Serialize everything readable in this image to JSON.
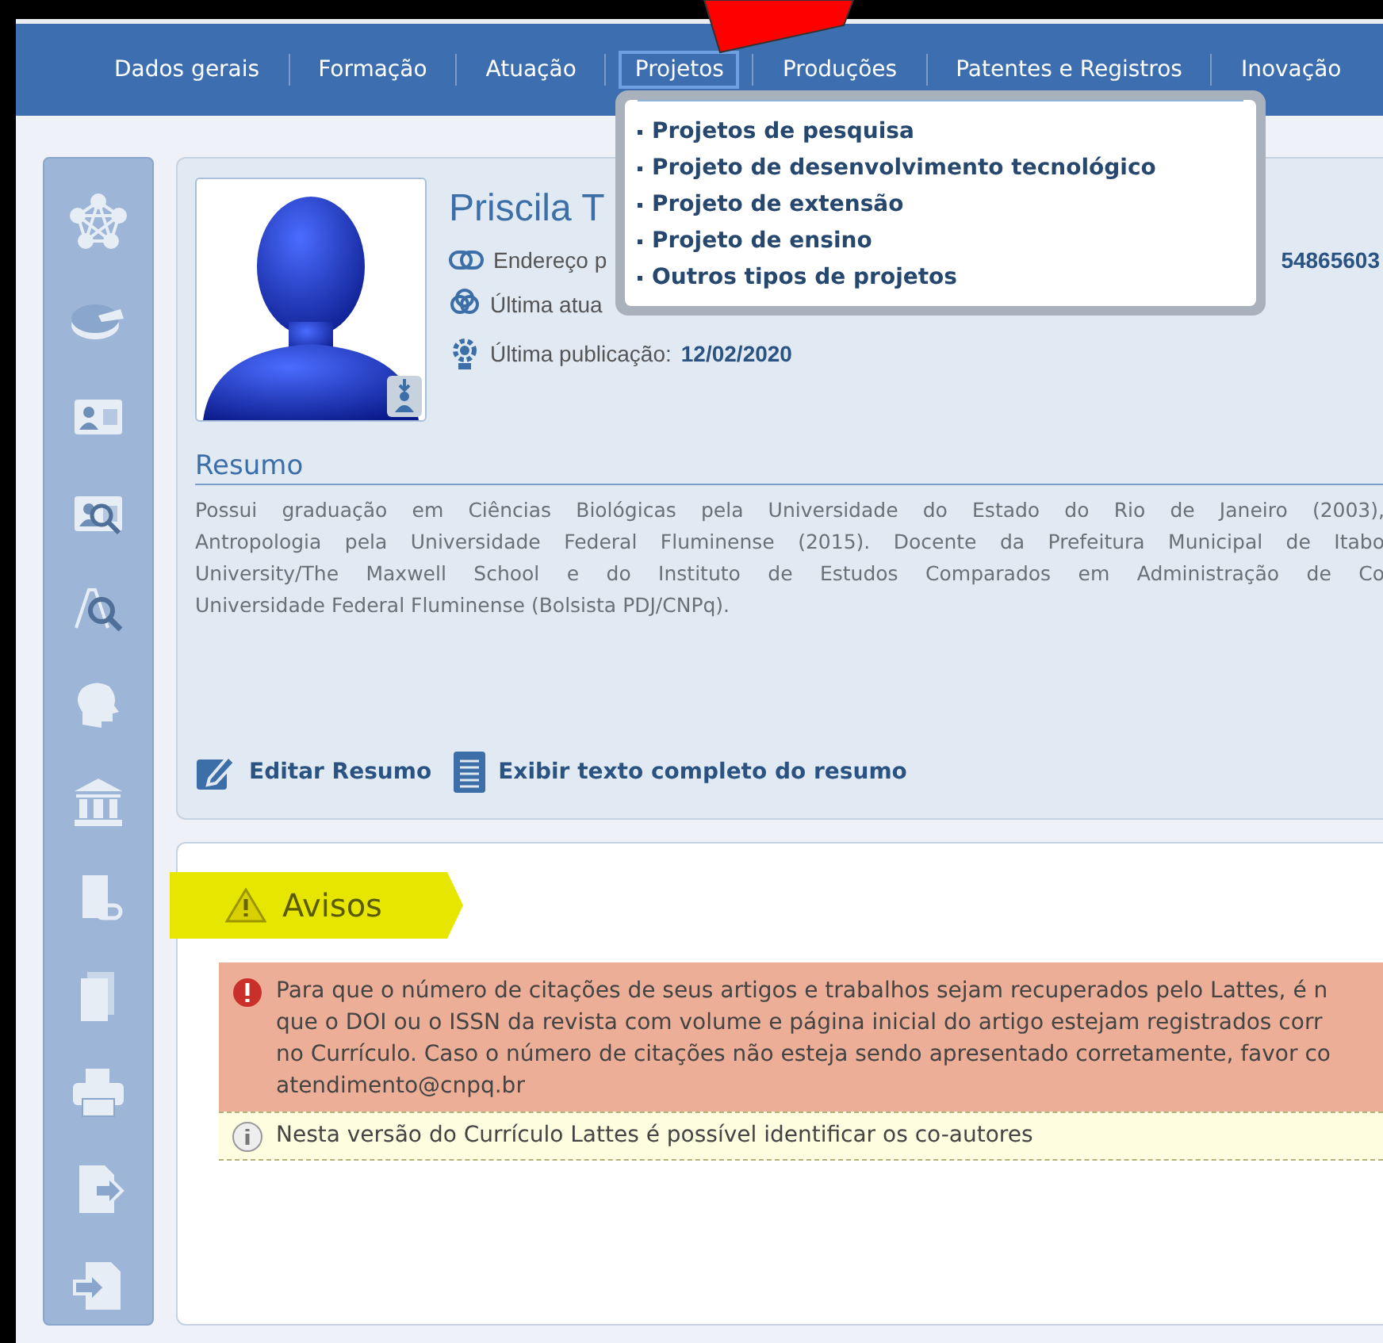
{
  "nav": {
    "items": [
      {
        "label": "Dados gerais",
        "selected": false
      },
      {
        "label": "Formação",
        "selected": false
      },
      {
        "label": "Atuação",
        "selected": false
      },
      {
        "label": "Projetos",
        "selected": true
      },
      {
        "label": "Produções",
        "selected": false
      },
      {
        "label": "Patentes e Registros",
        "selected": false
      },
      {
        "label": "Inovação",
        "selected": false
      }
    ]
  },
  "dropdown": {
    "items": [
      "Projetos de pesquisa",
      "Projeto de desenvolvimento tecnológico",
      "Projeto de extensão",
      "Projeto de ensino",
      "Outros tipos de projetos"
    ]
  },
  "profile": {
    "name": "Priscila T",
    "address_label": "Endereço p",
    "address_value": "54865603",
    "update_label": "Última atua",
    "publication_label": "Última publicação:",
    "publication_date": "12/02/2020"
  },
  "summary": {
    "title": "Resumo",
    "lines": [
      "Possui graduação em Ciências Biológicas pela Universidade do Estado do Rio de Janeiro (2003),",
      "Antropologia pela Universidade Federal Fluminense (2015). Docente da Prefeitura Municipal de Itabo",
      "University/The Maxwell School e do Instituto de Estudos Comparados em Administração de Co",
      "Universidade Federal Fluminense (Bolsista PDJ/CNPq)."
    ],
    "actions": [
      {
        "kind": "edit",
        "label": "Editar Resumo"
      },
      {
        "kind": "full",
        "label": "Exibir texto completo do resumo"
      }
    ]
  },
  "notices": {
    "title": "Avisos",
    "items": [
      {
        "kind": "error",
        "lines": [
          "Para que o número de citações de seus artigos e trabalhos sejam recuperados pelo Lattes, é n",
          "que o DOI ou o ISSN da revista com volume e página inicial do artigo estejam registrados corr",
          "no Currículo. Caso o número de citações não esteja sendo apresentado corretamente, favor co",
          "atendimento@cnpq.br"
        ]
      },
      {
        "kind": "info",
        "lines": [
          "Nesta versão do Currículo Lattes é possível identificar os co-autores"
        ]
      }
    ]
  }
}
